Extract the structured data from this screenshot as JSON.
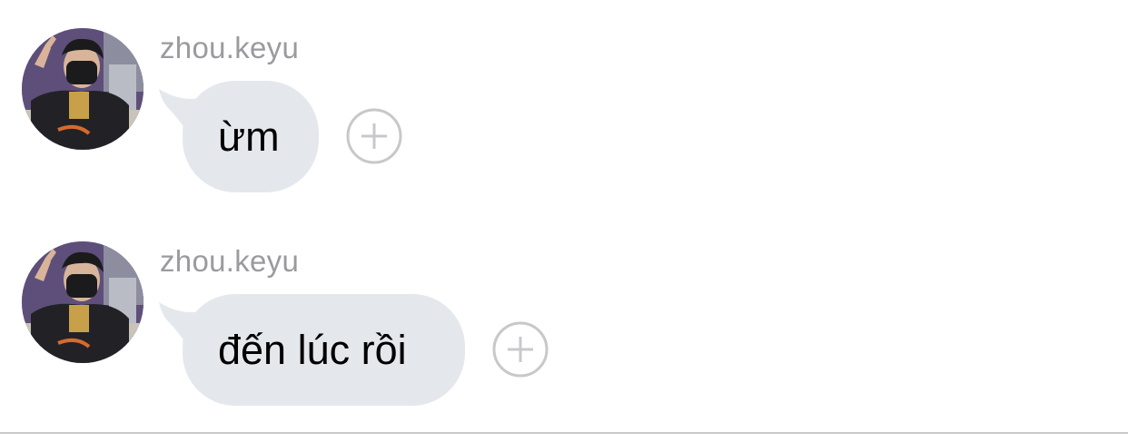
{
  "messages": [
    {
      "sender": "zhou.keyu",
      "text": "ừm",
      "avatar_icon": "user-photo-avatar",
      "action_icon": "plus-circle-icon"
    },
    {
      "sender": "zhou.keyu",
      "text": "đến lúc rồi",
      "avatar_icon": "user-photo-avatar",
      "action_icon": "plus-circle-icon"
    }
  ],
  "colors": {
    "bubble": "#e4e8ec",
    "sender_text": "#9a9a9f",
    "message_text": "#000000",
    "add_icon": "#c8c8cc",
    "divider": "#c9c9cc"
  }
}
